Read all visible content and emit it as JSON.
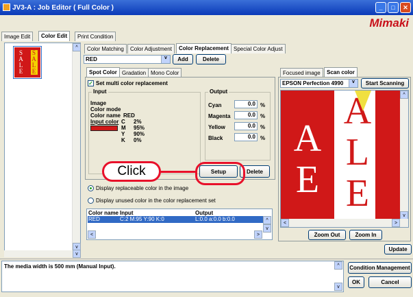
{
  "window": {
    "title": "JV3-A : Job Editor ( Full Color )",
    "brand": "Mimaki"
  },
  "main_tabs": [
    "Image Edit",
    "Color Edit",
    "Print Condition"
  ],
  "sub_tabs": [
    "Color Matching",
    "Color Adjustment",
    "Color Replacement",
    "Special Color Adjust"
  ],
  "replacement": {
    "selected": "RED",
    "add_label": "Add",
    "delete_label": "Delete"
  },
  "inner_tabs": [
    "Spot Color",
    "Gradation",
    "Mono Color"
  ],
  "multi_color": "Set multi color replacement",
  "input": {
    "title": "Input",
    "image": "Image",
    "color_mode": "Color mode",
    "color_name_label": "Color name",
    "color_name": "RED",
    "input_color_label": "Input color",
    "c": "C",
    "c_val": "2%",
    "m": "M",
    "m_val": "95%",
    "y": "Y",
    "y_val": "90%",
    "k": "K",
    "k_val": "0%"
  },
  "output": {
    "title": "Output",
    "cyan": "Cyan",
    "cyan_val": "0.0",
    "magenta": "Magenta",
    "magenta_val": "0.0",
    "yellow": "Yellow",
    "yellow_val": "0.0",
    "black": "Black",
    "black_val": "0.0",
    "unit": "%"
  },
  "setup_label": "Setup",
  "delete2_label": "Delete",
  "click_label": "Click",
  "radio1": "Display replaceable color in the image",
  "radio2": "Display unused color in the color replacement set",
  "list": {
    "headers": [
      "Color name",
      "Input",
      "Output"
    ],
    "row": [
      "RED",
      "C:2 M:95 Y:90 K:0",
      "L:0.0 a:0.0 b:0.0"
    ]
  },
  "right_tabs": [
    "Focused image",
    "Scan color"
  ],
  "scanner": "EPSON Perfection 4990",
  "start_scanning": "Start Scanning",
  "zoom_out": "Zoom Out",
  "zoom_in": "Zoom In",
  "update": "Update",
  "status": "The media width is 500 mm (Manual Input).",
  "condition_mgmt": "Condition Management",
  "ok": "OK",
  "cancel": "Cancel",
  "thumb_text": "SALE",
  "colors": {
    "accent": "#c8101a",
    "red": "#d01818",
    "highlight": "#316ac5"
  }
}
